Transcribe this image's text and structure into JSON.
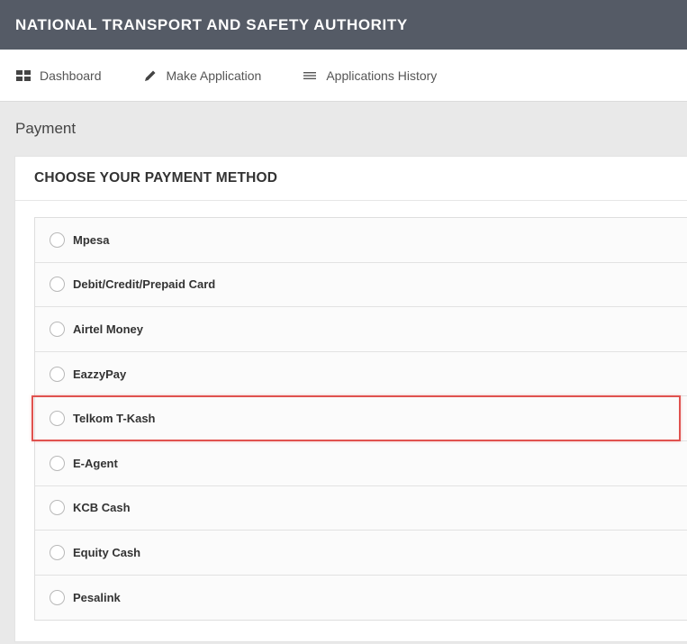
{
  "header": {
    "title": "NATIONAL TRANSPORT AND SAFETY AUTHORITY",
    "background": "#555b66"
  },
  "nav": {
    "items": [
      {
        "label": "Dashboard",
        "icon": "dashboard-grid-icon"
      },
      {
        "label": "Make Application",
        "icon": "pencil-icon"
      },
      {
        "label": "Applications History",
        "icon": "list-icon"
      }
    ]
  },
  "page": {
    "title": "Payment"
  },
  "payment": {
    "heading": "CHOOSE YOUR PAYMENT METHOD",
    "options": [
      {
        "label": "Mpesa",
        "selected": false
      },
      {
        "label": "Debit/Credit/Prepaid Card",
        "selected": false
      },
      {
        "label": "Airtel Money",
        "selected": false
      },
      {
        "label": "EazzyPay",
        "selected": false
      },
      {
        "label": "Telkom T-Kash",
        "selected": false,
        "highlighted": true
      },
      {
        "label": "E-Agent",
        "selected": false
      },
      {
        "label": "KCB Cash",
        "selected": false
      },
      {
        "label": "Equity Cash",
        "selected": false
      },
      {
        "label": "Pesalink",
        "selected": false
      }
    ],
    "highlight_color": "#e0524f"
  }
}
